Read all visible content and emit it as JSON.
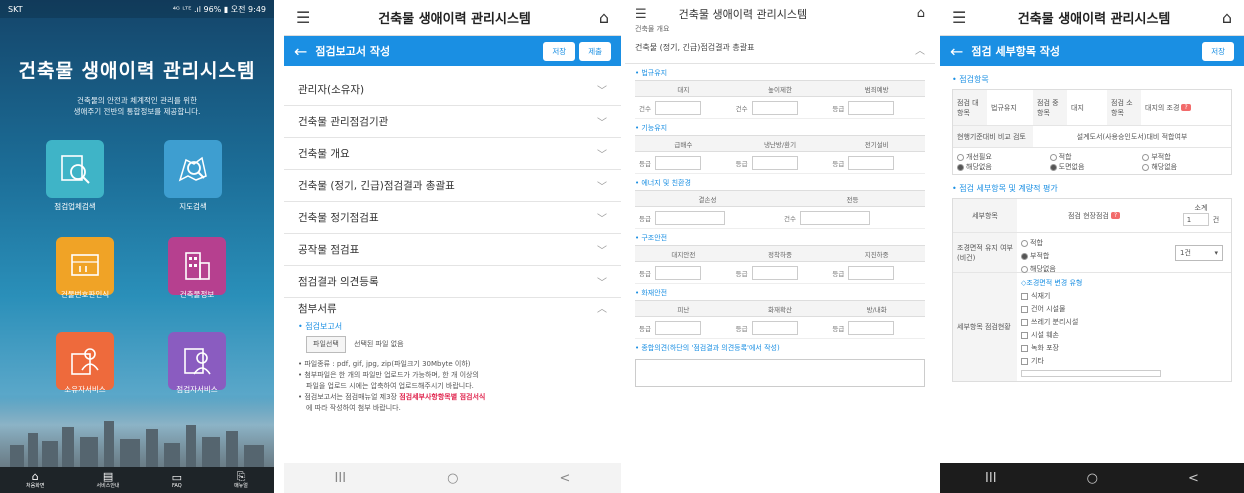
{
  "screen1": {
    "status_left": "SKT",
    "status_right": "⁴ᴳ ᴸᵀᴱ .ıl 96% ▮ 오전 9:49",
    "title": "건축물 생애이력 관리시스템",
    "subtitle_line1": "건축물의 안전과 체계적인 관리를 위한",
    "subtitle_line2": "생애주기 전반의 통합정보를 제공합니다.",
    "tiles": [
      {
        "label": "점검업체검색",
        "color": "#3fb4c7",
        "icon": "search-document-icon"
      },
      {
        "label": "지도검색",
        "color": "#3e9ed0",
        "icon": "map-search-icon"
      },
      {
        "label": "건물번호판인식",
        "color": "#f0a326",
        "icon": "building-sign-icon"
      },
      {
        "label": "건축물정보",
        "color": "#b6408f",
        "icon": "building-icon"
      },
      {
        "label": "소유자서비스",
        "color": "#ee6a3c",
        "icon": "owner-service-icon"
      },
      {
        "label": "점검자서비스",
        "color": "#8a5cc0",
        "icon": "inspector-service-icon"
      }
    ],
    "bottom_nav": [
      {
        "glyph": "⌂",
        "label": "처음화면"
      },
      {
        "glyph": "▤",
        "label": "서비스안내"
      },
      {
        "glyph": "▭",
        "label": "FAQ"
      },
      {
        "glyph": "⎘",
        "label": "매뉴얼"
      }
    ]
  },
  "screen2": {
    "header_title": "건축물 생애이력 관리시스템",
    "page_title": "점검보고서 작성",
    "save_label": "저장",
    "submit_label": "제출",
    "accordion": [
      "관리자(소유자)",
      "건축물 관리점검기관",
      "건축물 개요",
      "건축물 (정기, 긴급)점검결과 총괄표",
      "건축물 정기점검표",
      "공작물 점검표",
      "점검결과 의견등록"
    ],
    "attach_title": "첨부서류",
    "attach_sub": "• 점검보고서",
    "file_button": "파일선택",
    "file_none": "선택된 파일 없음",
    "note1": "• 파일종류 : pdf, gif, jpg, zip(파일크기 30Mbyte 이하)",
    "note2a": "• 첨부파일은 한 개의 파일만 업로드가 가능하며, 한 개 이상의",
    "note2b": "파일을 업로드 시에는 압축하여 업로드해주시기 바랍니다.",
    "note3a": "• 점검보고서는 점검매뉴얼 제3장",
    "note3_red": "점검세부사항항목별 점검서식",
    "note3b": "에 따라 작성하여 첨부 바랍니다.",
    "nav": [
      "III",
      "○",
      "<"
    ]
  },
  "screen3": {
    "header_title": "건축물 생애이력 관리시스템",
    "prev_section": "건축물 개요",
    "section": "건축물 (정기, 긴급)점검결과 총괄표",
    "groups": [
      {
        "name": "• 법규유지",
        "cols": [
          "대지",
          "높이제한",
          "범죄예방"
        ],
        "rows": [
          [
            "건수",
            "건수",
            "등급"
          ]
        ]
      },
      {
        "name": "• 기능유지",
        "cols": [
          "급배수",
          "냉난방/환기",
          "전기설비"
        ],
        "rows": [
          [
            "등급",
            "등급",
            "등급"
          ]
        ]
      },
      {
        "name": "• 에너지 및 친환경",
        "cols": [
          "결손성",
          "전등"
        ],
        "rows": [
          [
            "등급",
            "건수"
          ]
        ]
      },
      {
        "name": "• 구조안전",
        "cols": [
          "대지안전",
          "정착하중",
          "지진하중"
        ],
        "rows": [
          [
            "등급",
            "등급",
            "등급"
          ]
        ]
      },
      {
        "name": "• 화재안전",
        "cols": [
          "피난",
          "화재확산",
          "방/내화"
        ],
        "rows": [
          [
            "등급",
            "등급",
            "등급"
          ]
        ]
      }
    ],
    "opinion_label": "• 종합의견(하단의 '점검결과 의견등록'에서 작성)"
  },
  "screen4": {
    "header_title": "건축물 생애이력 관리시스템",
    "page_title": "점검 세부항목 작성",
    "save_label": "저장",
    "sec1": "• 점검항목",
    "r1": [
      "점검 대항목",
      "법규유지",
      "점검 중항목",
      "대지",
      "점검 소항목",
      "대지의 조경"
    ],
    "badge": "?",
    "r2": [
      "현행기준대비 비교 검토",
      "설계도서(사용승인도서)대비 적합여부"
    ],
    "r3a": [
      "개선필요",
      "해당없음"
    ],
    "r3b": [
      "적합",
      "도면없음"
    ],
    "r3c": [
      "부적합",
      "해당없음"
    ],
    "sec2": "• 점검 세부항목 및 계량적 평가",
    "col_a": "세부항목",
    "col_b": "점검 현장점검",
    "col_c": "소계",
    "qty": "1",
    "unit": "건",
    "row_label": "조경면적 유지 여부 (비건)",
    "opts": [
      "적합",
      "부적합",
      "해당없음"
    ],
    "select_value": "1건",
    "detail_label": "세부항목 점검현황",
    "change_title": "◇조경면적 변경 유형",
    "change_items": [
      "식재기",
      "건어 시설물",
      "쓰레기 분리시설",
      "시설 훼손",
      "녹화 포장",
      "기타"
    ],
    "nav": [
      "III",
      "○",
      "<"
    ]
  }
}
